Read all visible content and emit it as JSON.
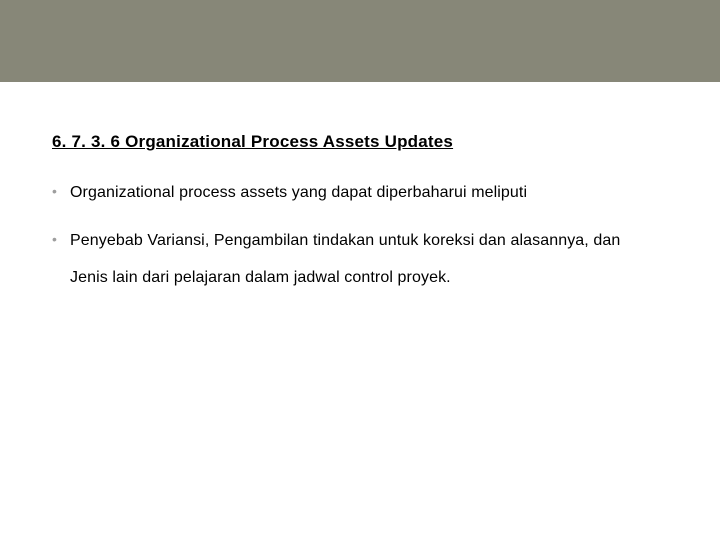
{
  "heading": "6. 7. 3. 6 Organizational Process Assets Updates",
  "bullets": [
    {
      "text": "Organizational process assets yang dapat diperbaharui meliputi"
    },
    {
      "text": "Penyebab Variansi, Pengambilan tindakan untuk koreksi dan alasannya, dan",
      "cont": "Jenis lain dari pelajaran dalam jadwal control proyek."
    }
  ]
}
